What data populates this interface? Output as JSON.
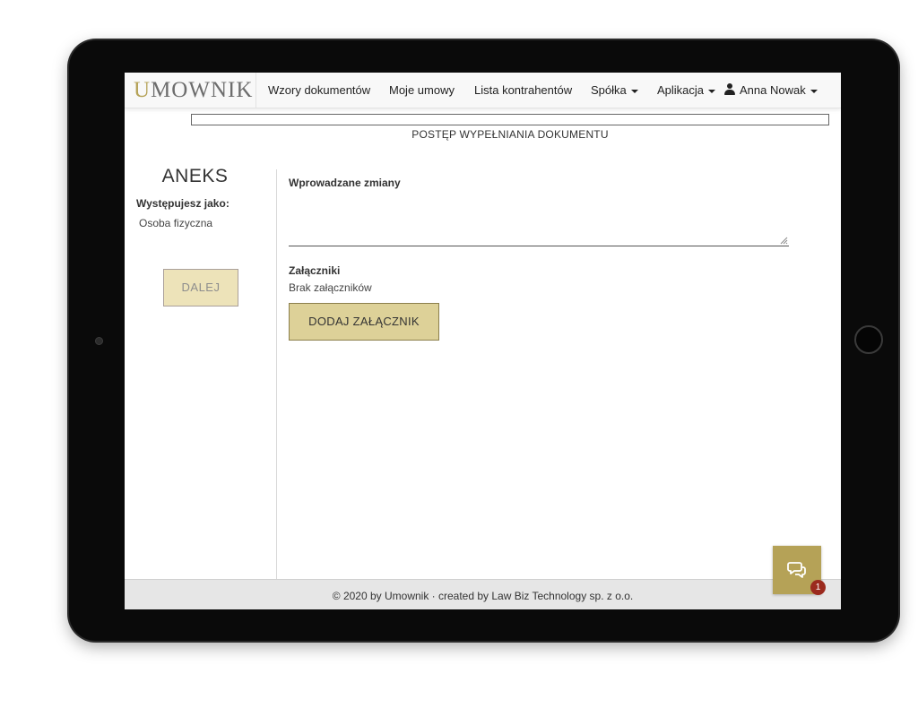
{
  "brand": {
    "logo_first_letter": "U",
    "logo_rest": "MOWNIK",
    "accent_color": "#b5a257"
  },
  "nav": {
    "items": [
      {
        "label": "Wzory dokumentów",
        "has_caret": false
      },
      {
        "label": "Moje umowy",
        "has_caret": false
      },
      {
        "label": "Lista kontrahentów",
        "has_caret": false
      },
      {
        "label": "Spółka",
        "has_caret": true
      },
      {
        "label": "Aplikacja",
        "has_caret": true
      }
    ],
    "user": {
      "name": "Anna Nowak",
      "icon": "user-icon",
      "has_caret": true
    }
  },
  "progress": {
    "label": "POSTĘP WYPEŁNIANIA DOKUMENTU",
    "value_percent": 0
  },
  "sidebar": {
    "document_title": "ANEKS",
    "role_label": "Występujesz jako:",
    "role_value": "Osoba fizyczna",
    "next_button_label": "DALEJ",
    "next_button_enabled": false
  },
  "form": {
    "changes_label": "Wprowadzane zmiany",
    "changes_value": "",
    "attachments_label": "Załączniki",
    "attachments_empty_text": "Brak załączników",
    "add_attachment_label": "DODAJ ZAŁĄCZNIK"
  },
  "footer": {
    "text": "© 2020 by Umownik · created by Law Biz Technology sp. z o.o."
  },
  "chat": {
    "icon": "chat-bubbles-icon",
    "badge_count": "1",
    "badge_color": "#9b2a1e"
  }
}
